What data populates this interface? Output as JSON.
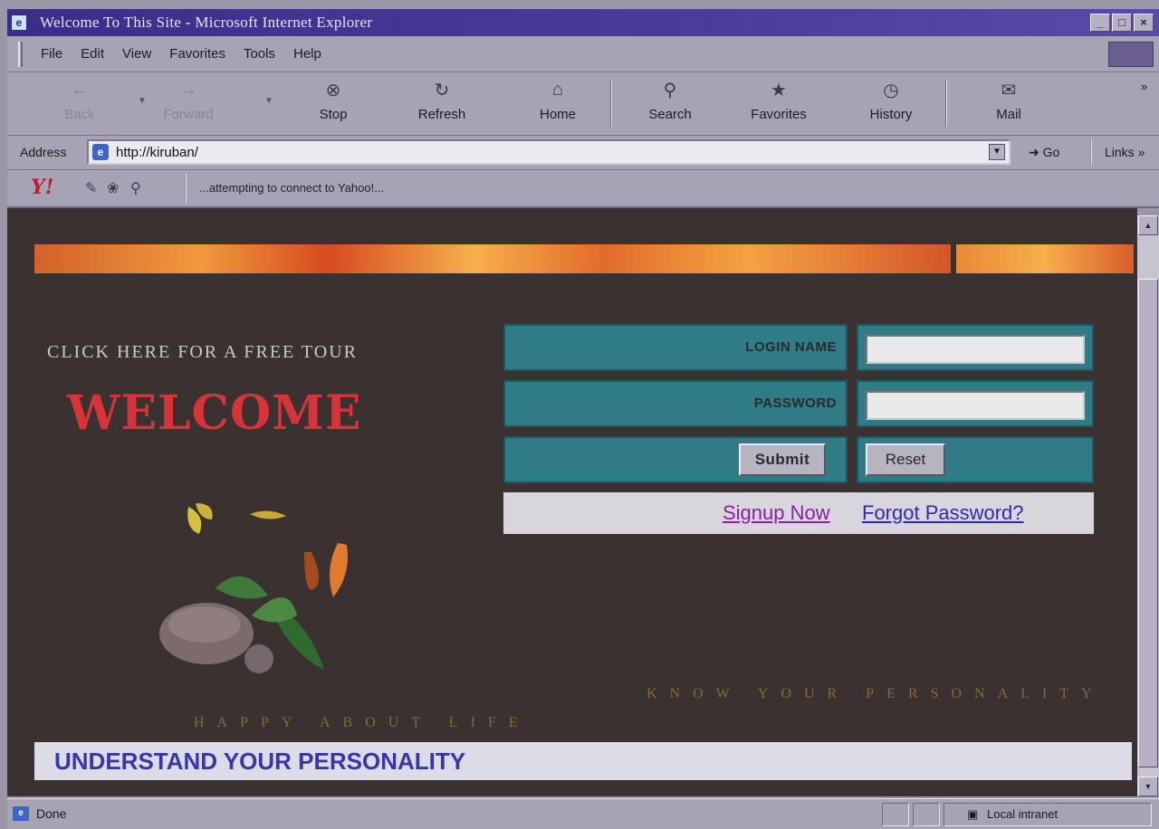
{
  "window": {
    "title": "Welcome To This Site - Microsoft Internet Explorer",
    "controls": [
      "_",
      "□",
      "×"
    ]
  },
  "menu": [
    "File",
    "Edit",
    "View",
    "Favorites",
    "Tools",
    "Help"
  ],
  "toolbar": {
    "back": "Back",
    "forward": "Forward",
    "stop": "Stop",
    "refresh": "Refresh",
    "home": "Home",
    "search": "Search",
    "favorites": "Favorites",
    "history": "History",
    "mail": "Mail",
    "more": "»"
  },
  "address": {
    "label": "Address",
    "url": "http://kiruban/",
    "go": "Go",
    "links": "Links »"
  },
  "yahoo_bar": {
    "logo": "Y!",
    "status": "...attempting to connect to Yahoo!..."
  },
  "page": {
    "tour_link": "CLICK HERE FOR A FREE TOUR",
    "welcome": "WELCOME",
    "login_name_label": "LOGIN NAME",
    "password_label": "PASSWORD",
    "login_name_value": "",
    "password_value": "",
    "submit": "Submit",
    "reset": "Reset",
    "signup": "Signup Now",
    "forgot": "Forgot Password?",
    "faint_right": "KNOW YOUR PERSONALITY",
    "faint_left": "HAPPY ABOUT LIFE",
    "banner": "UNDERSTAND YOUR PERSONALITY"
  },
  "status": {
    "text": "Done",
    "zone": "Local intranet"
  },
  "colors": {
    "page_bg": "#3a3131",
    "welcome": "#d9333a",
    "form_cells": "#2f7c86",
    "banner_text": "#3a36a8"
  }
}
